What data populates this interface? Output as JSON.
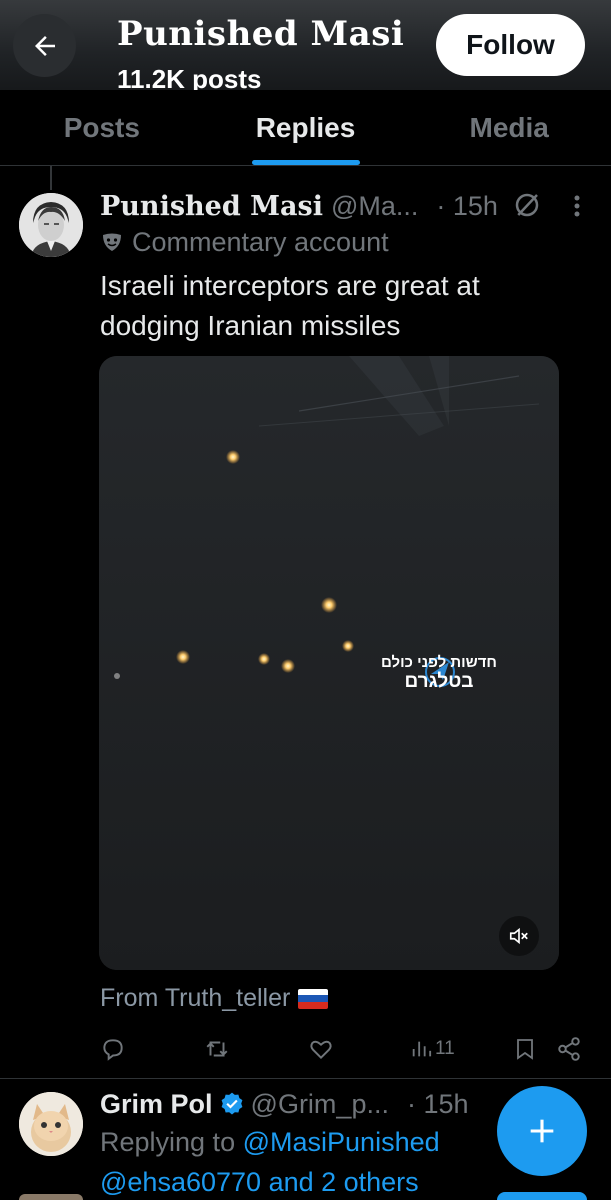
{
  "header": {
    "title": "Punished Masi",
    "posts_count": "11.2K posts",
    "follow_label": "Follow",
    "back_icon": "arrow-left-icon"
  },
  "tabs": [
    {
      "label": "Posts",
      "active": false
    },
    {
      "label": "Replies",
      "active": true
    },
    {
      "label": "Media",
      "active": false
    }
  ],
  "post": {
    "author_name": "Punished Masi",
    "author_handle": "@Ma...",
    "time": "· 15h",
    "label": "Commentary account",
    "text": "Israeli interceptors are great at dodging Iranian missiles",
    "media": {
      "watermark_line1": "חדשות לפני כולם",
      "watermark_line2": "בטלגרם"
    },
    "source": "From Truth_teller",
    "source_flag": "russia-flag",
    "actions": {
      "views": "11"
    }
  },
  "reply": {
    "author_name": "Grim Pol",
    "author_handle": "@Grim_p...",
    "time": "· 15h",
    "replying_prefix": "Replying to",
    "mention1": "@MasiPunished",
    "mention2": "@ehsa60770",
    "others": "and 2 others"
  },
  "colors": {
    "accent": "#1d9bf0",
    "background": "#000000",
    "text": "#e7e9ea",
    "muted": "#71767b"
  }
}
